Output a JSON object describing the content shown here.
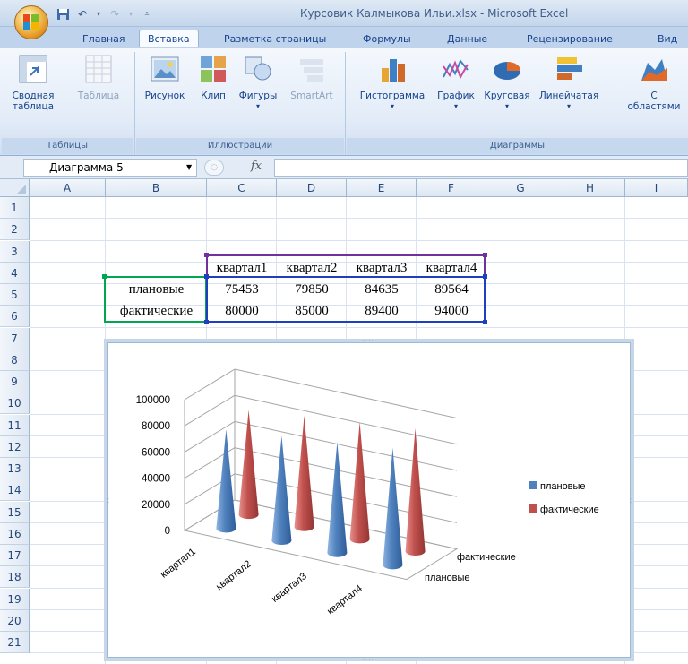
{
  "window": {
    "title": "Курсовик Калмыкова Ильи.xlsx - Microsoft Excel"
  },
  "tabs": [
    "Главная",
    "Вставка",
    "Разметка страницы",
    "Формулы",
    "Данные",
    "Рецензирование",
    "Вид"
  ],
  "active_tab": "Вставка",
  "ribbon": {
    "groups": {
      "tables": {
        "label": "Таблицы",
        "pivot_line1": "Сводная",
        "pivot_line2": "таблица",
        "table": "Таблица"
      },
      "illustrations": {
        "label": "Иллюстрации",
        "picture": "Рисунок",
        "clip": "Клип",
        "shapes": "Фигуры",
        "smartart": "SmartArt"
      },
      "charts": {
        "label": "Диаграммы",
        "histogram": "Гистограмма",
        "graph": "График",
        "pie": "Круговая",
        "linear": "Линейчатая",
        "area_line1": "С",
        "area_line2": "областями"
      }
    }
  },
  "formula_bar": {
    "name_box": "Диаграмма 5",
    "fx": "fx",
    "formula": ""
  },
  "sheet": {
    "columns": [
      "A",
      "B",
      "C",
      "D",
      "E",
      "F",
      "G",
      "H",
      "I"
    ],
    "rows": [
      "1",
      "2",
      "3",
      "4",
      "5",
      "6",
      "7",
      "8",
      "9",
      "10",
      "11",
      "12",
      "13",
      "14",
      "15",
      "16",
      "17",
      "18",
      "19",
      "20",
      "21"
    ],
    "headers": [
      "квартал1",
      "квартал2",
      "квартал3",
      "квартал4"
    ],
    "row_planned": {
      "label": "плановые",
      "values": [
        "75453",
        "79850",
        "84635",
        "89564"
      ]
    },
    "row_actual": {
      "label": "фактические",
      "values": [
        "80000",
        "85000",
        "89400",
        "94000"
      ]
    }
  },
  "chart_data": {
    "type": "3d-cone",
    "categories": [
      "квартал1",
      "квартал2",
      "квартал3",
      "квартал4"
    ],
    "series": [
      {
        "name": "плановые",
        "values": [
          75453,
          79850,
          84635,
          89564
        ],
        "color": "#4f81bd"
      },
      {
        "name": "фактические",
        "values": [
          80000,
          85000,
          89400,
          94000
        ],
        "color": "#c0504d"
      }
    ],
    "y_ticks": [
      "0",
      "20000",
      "40000",
      "60000",
      "80000",
      "100000"
    ],
    "ylim": [
      0,
      100000
    ],
    "depth_labels": [
      "фактические",
      "плановые"
    ],
    "legend_position": "right",
    "grid": true
  },
  "colors": {
    "accent": "#15428b",
    "range_purple": "#7030a0",
    "range_green": "#00a651",
    "range_blue": "#1f3fbf"
  }
}
